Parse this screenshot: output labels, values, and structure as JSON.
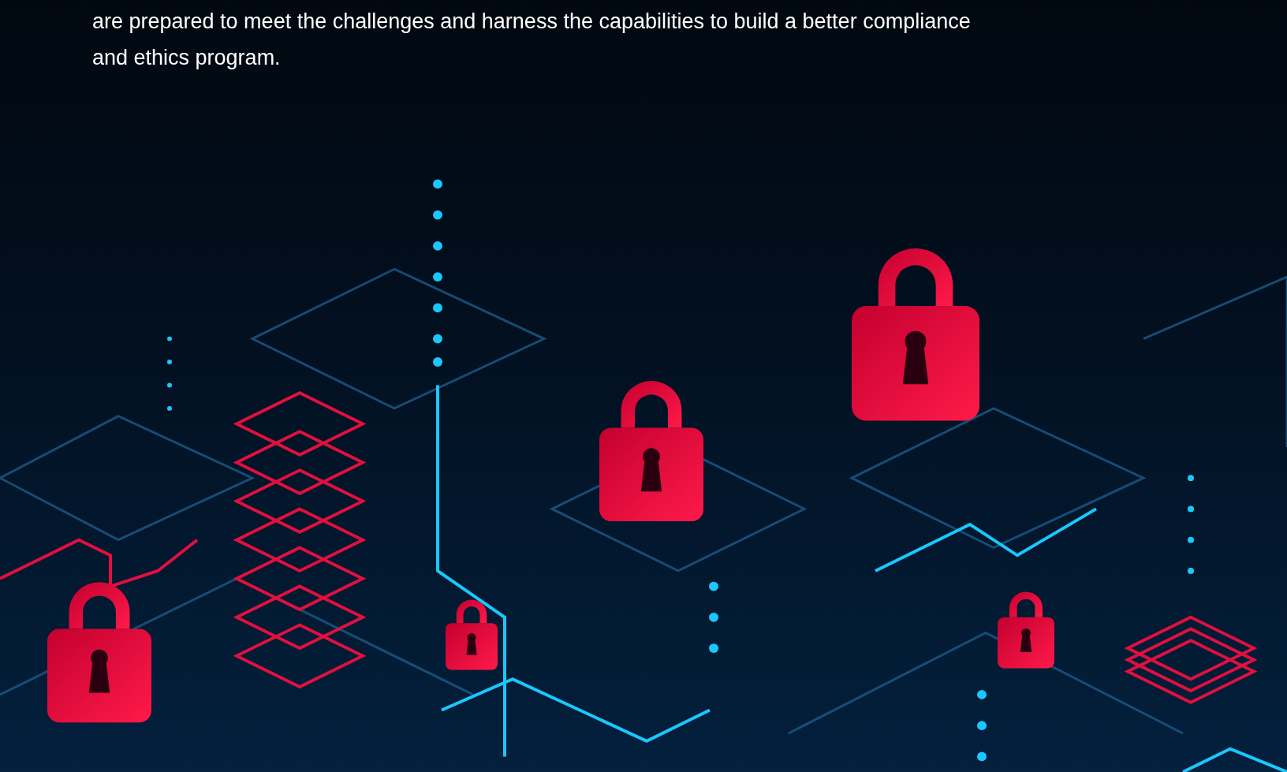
{
  "intro": {
    "text": "are prepared to meet the challenges and harness the capabilities to build a better compliance and ethics program."
  }
}
